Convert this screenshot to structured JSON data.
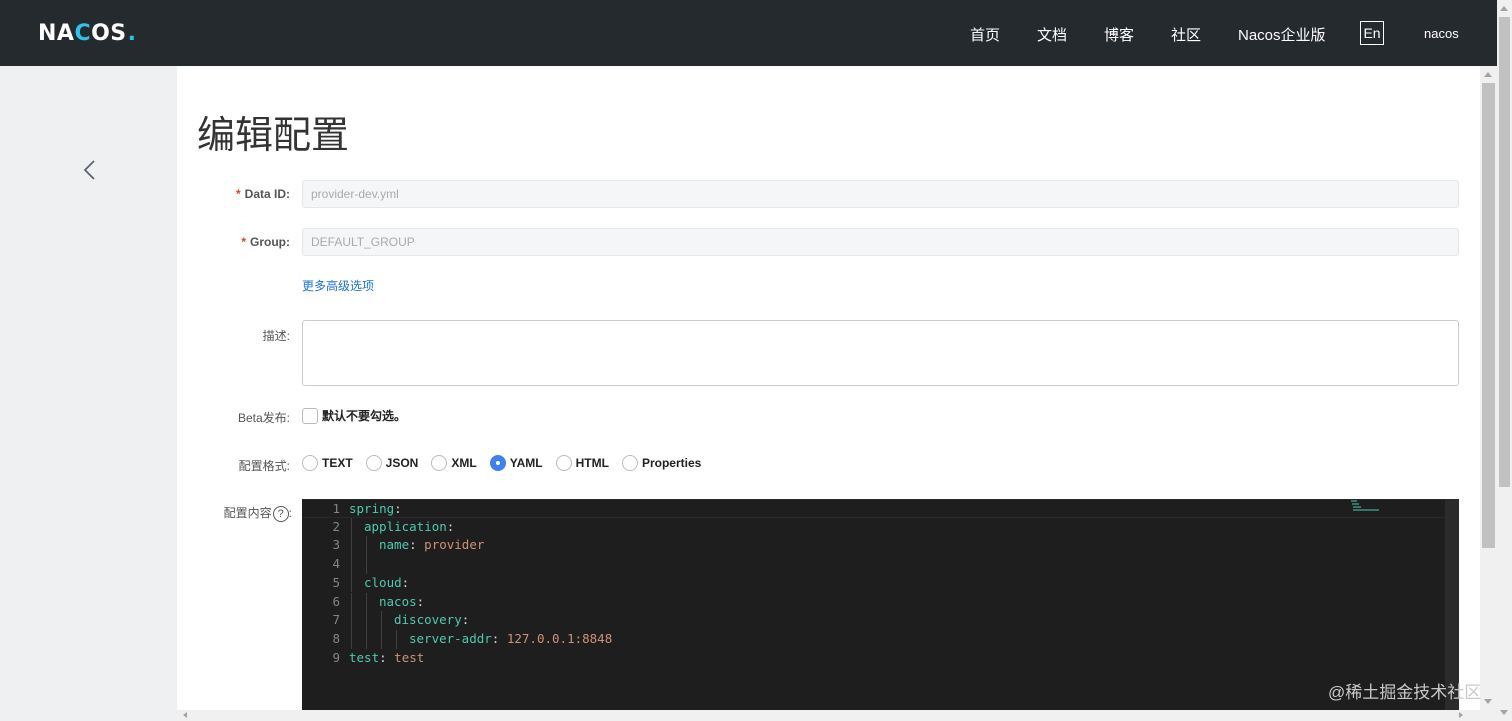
{
  "header": {
    "logo": "NACOS.",
    "nav": [
      "首页",
      "文档",
      "博客",
      "社区",
      "Nacos企业版"
    ],
    "lang": "En",
    "user": "nacos"
  },
  "page": {
    "title": "编辑配置"
  },
  "form": {
    "data_id_label": "Data ID:",
    "data_id_value": "provider-dev.yml",
    "group_label": "Group:",
    "group_value": "DEFAULT_GROUP",
    "advanced_link": "更多高级选项",
    "description_label": "描述:",
    "description_value": "",
    "beta_label": "Beta发布:",
    "beta_checkbox_text": "默认不要勾选。",
    "format_label": "配置格式:",
    "formats": [
      "TEXT",
      "JSON",
      "XML",
      "YAML",
      "HTML",
      "Properties"
    ],
    "selected_format": "YAML",
    "content_label": "配置内容",
    "content_help": "?",
    "content_colon": ":"
  },
  "editor": {
    "lines": [
      {
        "n": "1",
        "key": "spring",
        "val": ""
      },
      {
        "n": "2",
        "key": "application",
        "val": ""
      },
      {
        "n": "3",
        "key": "name",
        "val": "provider"
      },
      {
        "n": "4",
        "key": "",
        "val": ""
      },
      {
        "n": "5",
        "key": "cloud",
        "val": ""
      },
      {
        "n": "6",
        "key": "nacos",
        "val": ""
      },
      {
        "n": "7",
        "key": "discovery",
        "val": ""
      },
      {
        "n": "8",
        "key": "server-addr",
        "val": "127.0.0.1:8848"
      },
      {
        "n": "9",
        "key": "test",
        "val": "test"
      }
    ]
  },
  "watermark": "@稀土掘金技术社区",
  "colors": {
    "header_bg": "#252a2f",
    "accent": "#3f7ff0",
    "link": "#1d72d6",
    "required": "#e53935",
    "editor_bg": "#1e1e1e",
    "yaml_key": "#4ec9b0",
    "yaml_value": "#ce9178"
  }
}
